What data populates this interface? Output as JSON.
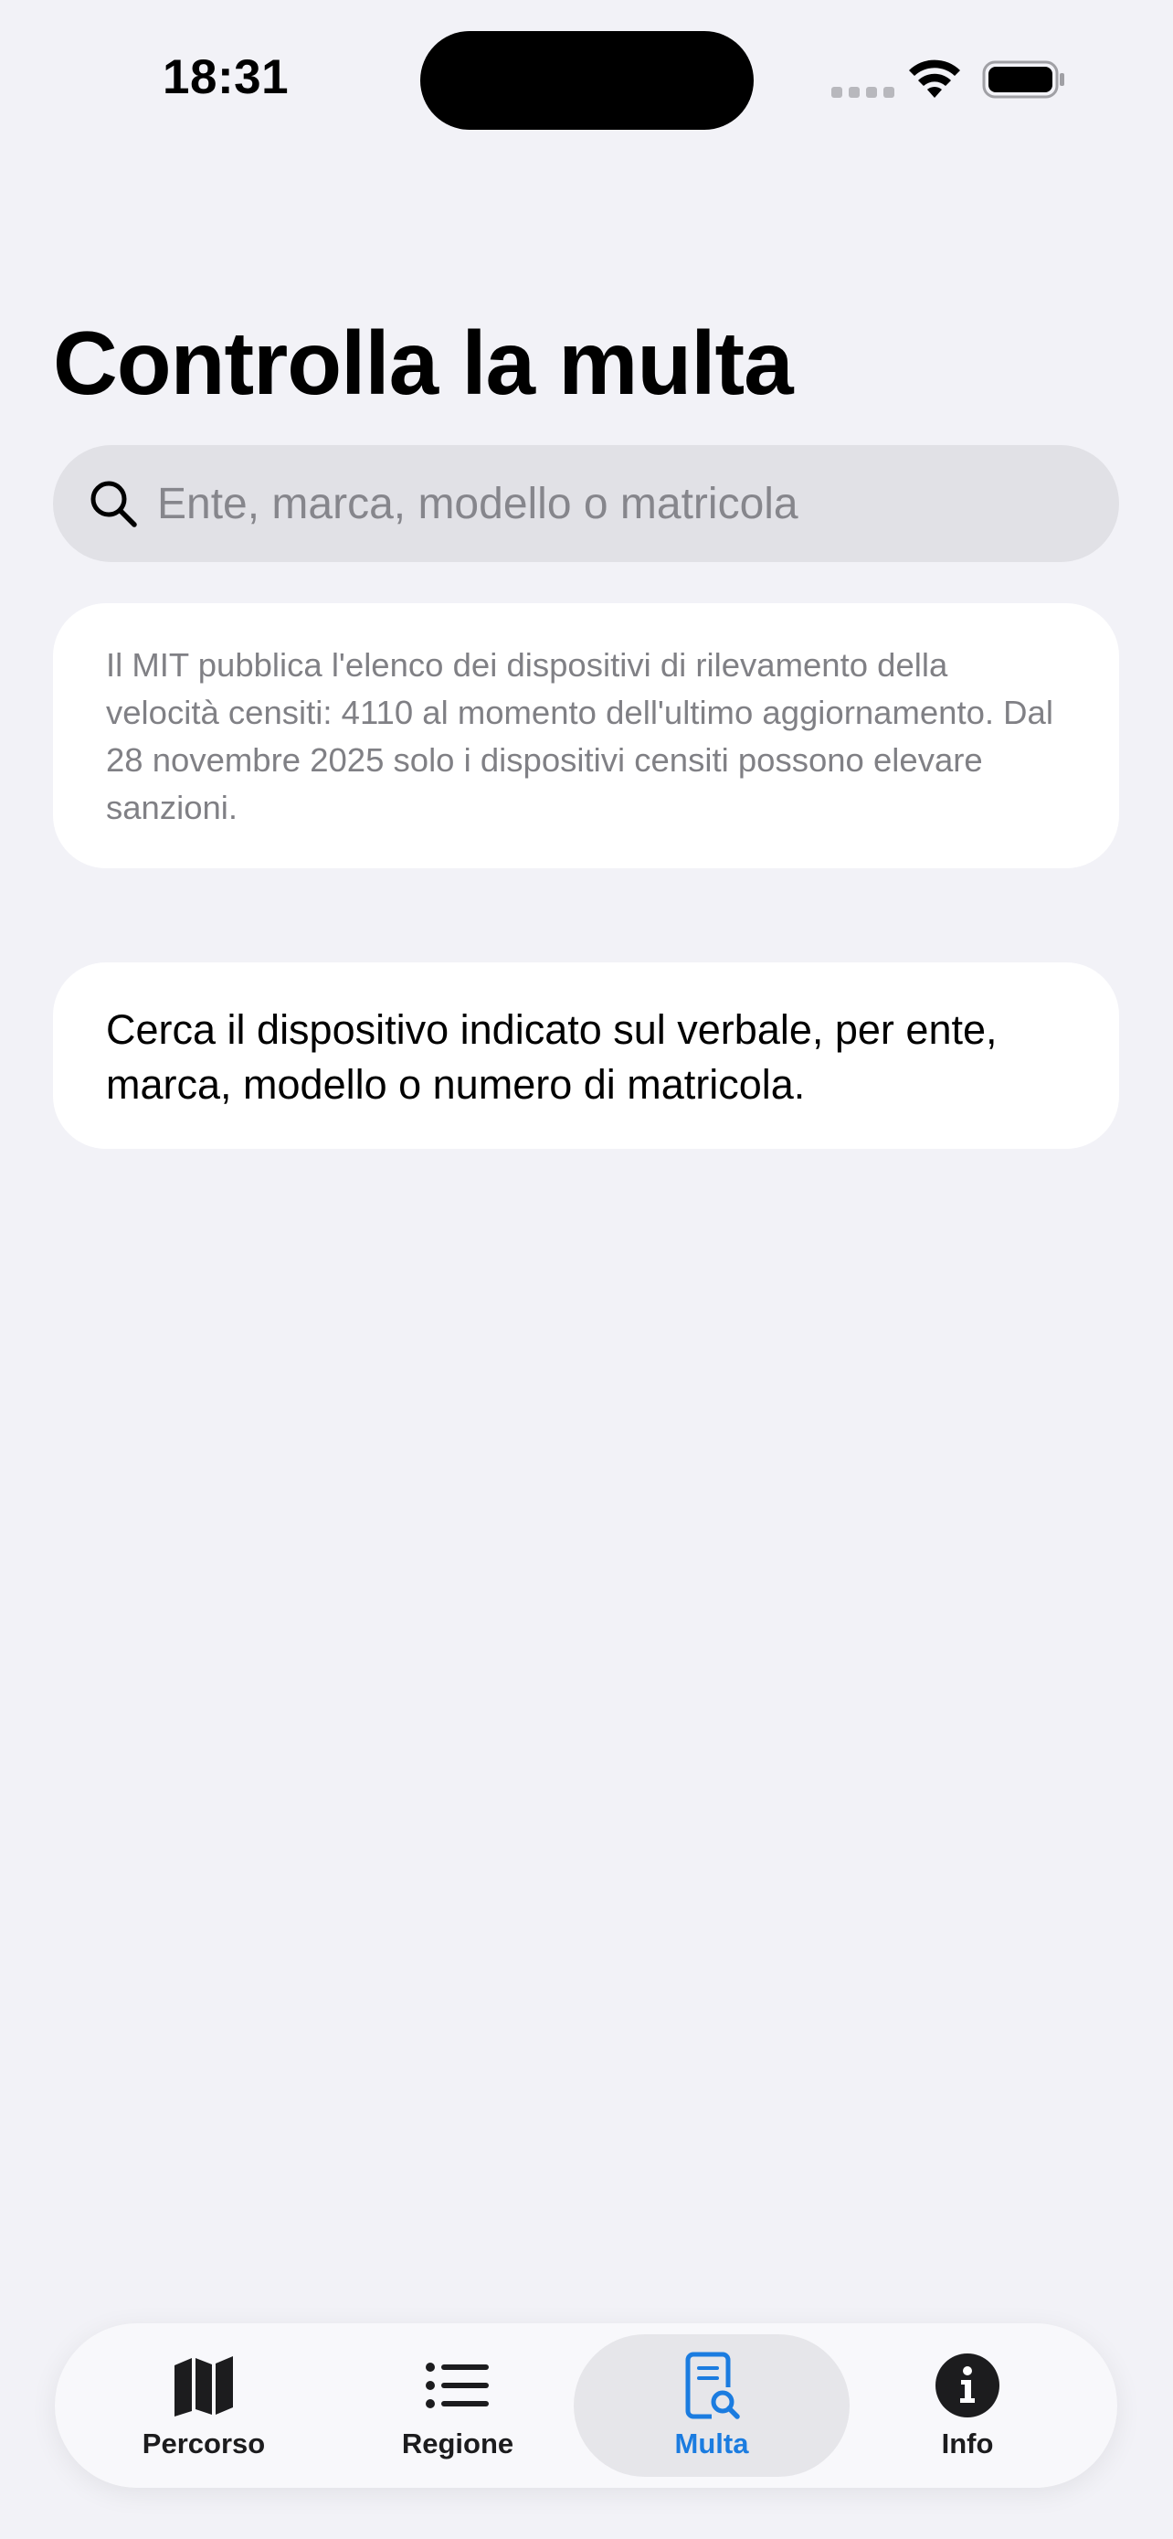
{
  "status_bar": {
    "time": "18:31",
    "icons": [
      "signal-dots-icon",
      "wifi-icon",
      "battery-icon"
    ]
  },
  "page": {
    "title": "Controlla la multa"
  },
  "search": {
    "placeholder": "Ente, marca, modello o matricola",
    "value": "",
    "icon": "search-icon"
  },
  "info_card": {
    "text": "Il MIT pubblica l'elenco dei dispositivi di rilevamento della velocità censiti: 4110 al momento dell'ultimo aggiornamento. Dal 28 novembre 2025 solo i dispositivi censiti possono elevare sanzioni."
  },
  "hint_card": {
    "text": "Cerca il dispositivo indicato sul verbale, per ente, marca, modello o numero di matricola."
  },
  "tab_bar": {
    "items": [
      {
        "label": "Percorso",
        "icon": "map-icon",
        "selected": false
      },
      {
        "label": "Regione",
        "icon": "list-icon",
        "selected": false
      },
      {
        "label": "Multa",
        "icon": "document-search-icon",
        "selected": true
      },
      {
        "label": "Info",
        "icon": "info-icon",
        "selected": false
      }
    ]
  },
  "colors": {
    "background": "#f2f2f7",
    "card": "#ffffff",
    "search_field": "#e1e1e6",
    "accent": "#1b7ce0",
    "secondary_text": "#808085"
  }
}
